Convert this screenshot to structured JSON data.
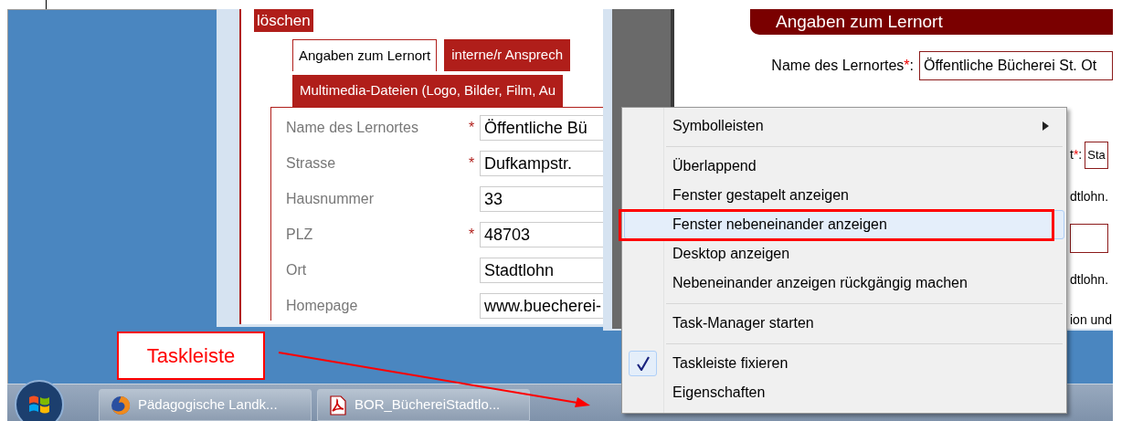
{
  "left_window": {
    "delete_button": "löschen",
    "tabs": [
      {
        "label": "Angaben zum Lernort",
        "selected": true
      },
      {
        "label": "interne/r Ansprech",
        "selected": false
      },
      {
        "label": "Multimedia-Dateien (Logo, Bilder, Film, Au",
        "selected": false
      }
    ],
    "fields": [
      {
        "label": "Name des Lernortes",
        "mark": "*",
        "value": "Öffentliche Bü"
      },
      {
        "label": "Strasse",
        "mark": "*",
        "value": "Dufkampstr."
      },
      {
        "label": "Hausnummer",
        "value": "33"
      },
      {
        "label": "PLZ",
        "mark": "*",
        "value": "48703"
      },
      {
        "label": "Ort",
        "value": "Stadtlohn"
      },
      {
        "label": "Homepage",
        "value": "www.buecherei-"
      }
    ]
  },
  "right_window": {
    "heading": "Angaben zum Lernort",
    "name_field": {
      "label": "Name des Lernortes",
      "mark": "*",
      "colon": ":",
      "value": "Öffentliche Bücherei St. Ot"
    },
    "fragments": [
      {
        "kind": "label_field",
        "label": "t",
        "mark": "*",
        "colon": ":",
        "value": "Sta"
      },
      {
        "kind": "text",
        "text": "dtlohn."
      },
      {
        "kind": "empty_field"
      },
      {
        "kind": "text",
        "text": "dtlohn."
      },
      {
        "kind": "text",
        "text": "ion und"
      }
    ]
  },
  "context_menu": [
    {
      "kind": "item",
      "label": "Symbolleisten",
      "submenu": true,
      "checked": false,
      "selected": false
    },
    {
      "kind": "separator"
    },
    {
      "kind": "item",
      "label": "Überlappend",
      "submenu": false,
      "checked": false,
      "selected": false
    },
    {
      "kind": "item",
      "label": "Fenster gestapelt anzeigen",
      "submenu": false,
      "checked": false,
      "selected": false
    },
    {
      "kind": "item",
      "label": "Fenster nebeneinander anzeigen",
      "submenu": false,
      "checked": false,
      "selected": true
    },
    {
      "kind": "item",
      "label": "Desktop anzeigen",
      "submenu": false,
      "checked": false,
      "selected": false
    },
    {
      "kind": "item",
      "label": "Nebeneinander anzeigen rückgängig machen",
      "submenu": false,
      "checked": false,
      "selected": false
    },
    {
      "kind": "separator"
    },
    {
      "kind": "item",
      "label": "Task-Manager starten",
      "submenu": false,
      "checked": false,
      "selected": false
    },
    {
      "kind": "separator"
    },
    {
      "kind": "item",
      "label": "Taskleiste fixieren",
      "submenu": false,
      "checked": true,
      "selected": false
    },
    {
      "kind": "item",
      "label": "Eigenschaften",
      "submenu": false,
      "checked": false,
      "selected": false
    }
  ],
  "taskbar": {
    "buttons": [
      {
        "label": "Pädagogische Landk..."
      },
      {
        "label": "BOR_BüchereiStadtlo..."
      }
    ]
  },
  "callout": {
    "label": "Taskleiste"
  }
}
